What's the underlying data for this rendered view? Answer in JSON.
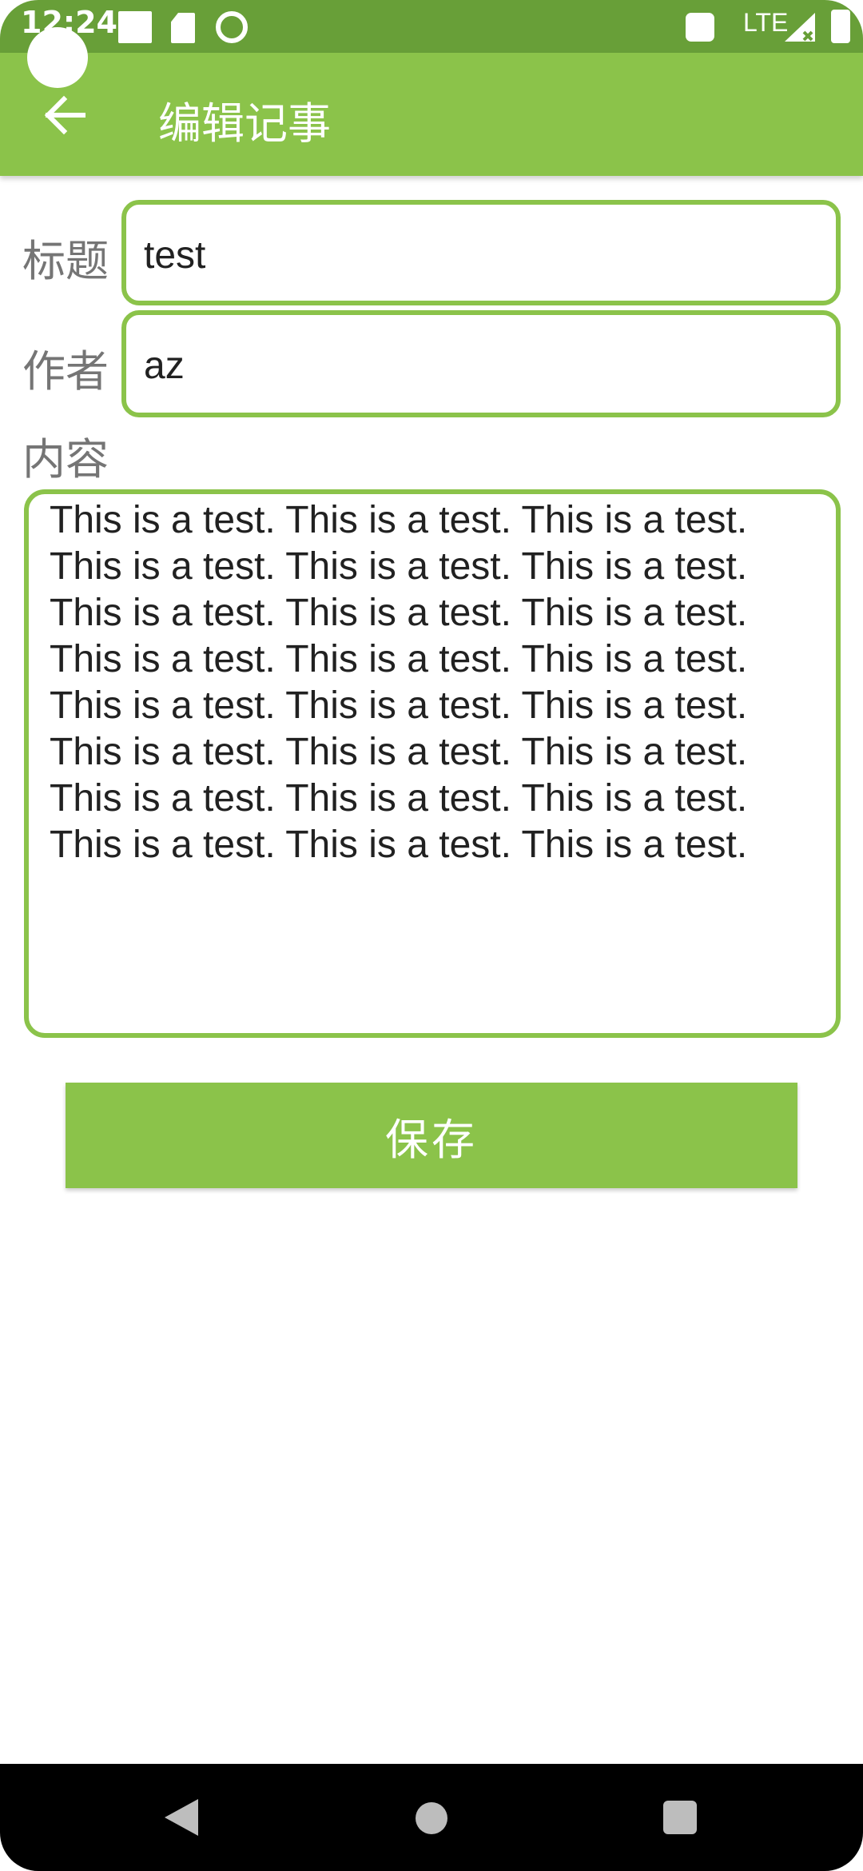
{
  "status_bar": {
    "time": "12:24",
    "network": "LTE",
    "icons": [
      "square-icon",
      "sd-card-icon",
      "sync-icon",
      "notification-icon",
      "signal-icon",
      "battery-icon"
    ]
  },
  "app_bar": {
    "title": "编辑记事",
    "back_icon": "arrow-back-icon"
  },
  "form": {
    "title_label": "标题",
    "title_value": "test",
    "author_label": "作者",
    "author_value": "az",
    "content_label": "内容",
    "content_lines": [
      "This is a test. This is a test. This is a test.",
      "This is a test. This is a test. This is a test.",
      "This is a test. This is a test. This is a test.",
      "This is a test. This is a test. This is a test.",
      "This is a test. This is a test. This is a test.",
      "This is a test. This is a test. This is a test.",
      "This is a test. This is a test. This is a test.",
      "This is a test. This is a test. This is a test."
    ],
    "save_label": "保存"
  },
  "colors": {
    "accent": "#8bc34a",
    "status_bar": "#689f38",
    "label_gray": "#757575"
  }
}
